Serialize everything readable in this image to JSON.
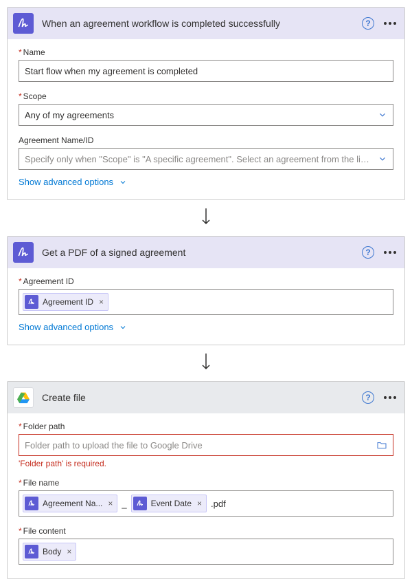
{
  "step1": {
    "title": "When an agreement workflow is completed successfully",
    "name_label": "Name",
    "name_value": "Start flow when my agreement is completed",
    "scope_label": "Scope",
    "scope_value": "Any of my agreements",
    "agreement_label": "Agreement Name/ID",
    "agreement_placeholder": "Specify only when \"Scope\" is \"A specific agreement\". Select an agreement from the list or enter th",
    "adv": "Show advanced options"
  },
  "step2": {
    "title": "Get a PDF of a signed agreement",
    "agreement_id_label": "Agreement ID",
    "token": "Agreement ID",
    "adv": "Show advanced options"
  },
  "step3": {
    "title": "Create file",
    "folder_label": "Folder path",
    "folder_placeholder": "Folder path to upload the file to Google Drive",
    "folder_error": "'Folder path' is required.",
    "filename_label": "File name",
    "filename_token1": "Agreement Na...",
    "filename_token2": "Event Date",
    "filename_sep": "_",
    "filename_suffix": ".pdf",
    "filecontent_label": "File content",
    "filecontent_token": "Body"
  }
}
